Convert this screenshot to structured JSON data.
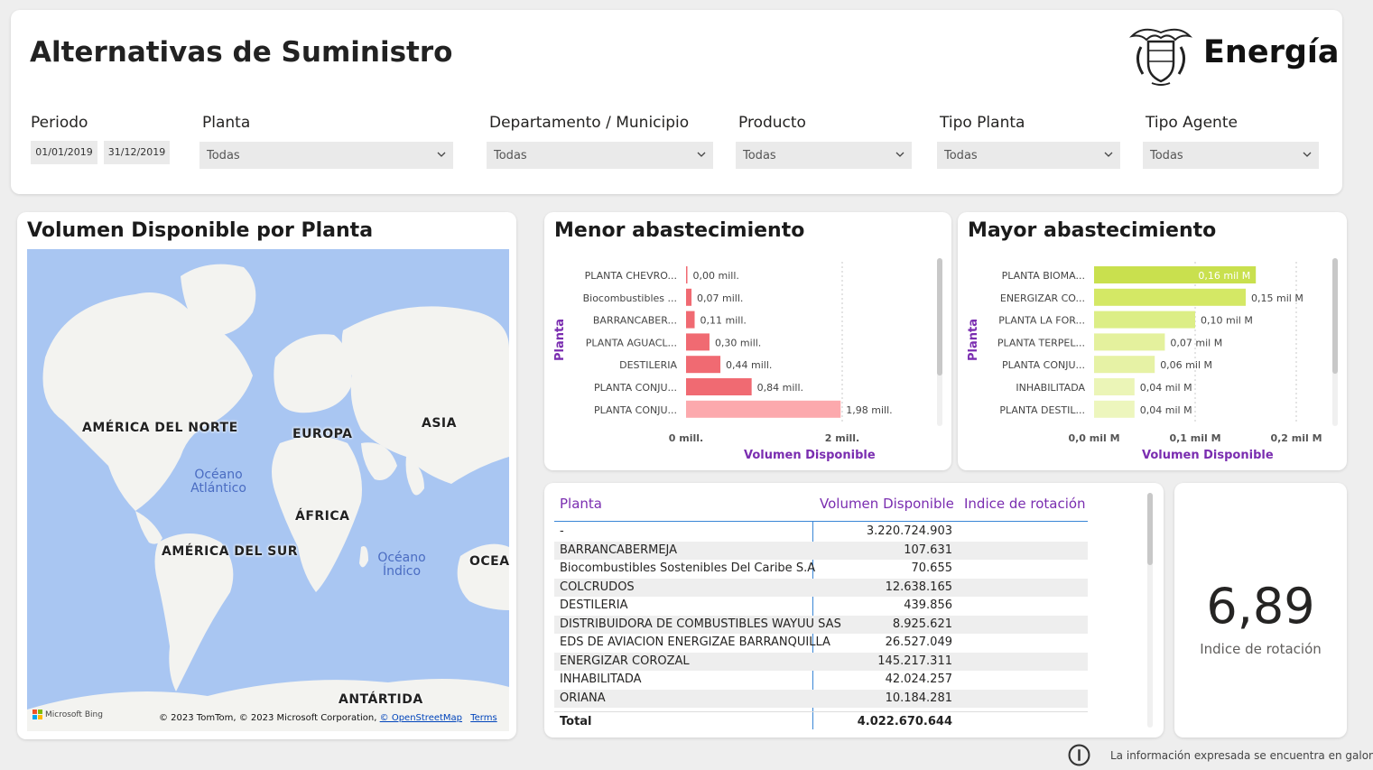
{
  "header": {
    "title": "Alternativas de Suministro",
    "logo_text": "Energía"
  },
  "filters": {
    "periodo": {
      "label": "Periodo",
      "from": "01/01/2019",
      "to": "31/12/2019"
    },
    "planta": {
      "label": "Planta",
      "value": "Todas"
    },
    "depto": {
      "label": "Departamento / Municipio",
      "value": "Todas"
    },
    "producto": {
      "label": "Producto",
      "value": "Todas"
    },
    "tipo_planta": {
      "label": "Tipo Planta",
      "value": "Todas"
    },
    "tipo_agente": {
      "label": "Tipo Agente",
      "value": "Todas"
    }
  },
  "map": {
    "title": "Volumen Disponible por Planta",
    "labels": {
      "na": "AMÉRICA DEL NORTE",
      "eu": "EUROPA",
      "as": "ASIA",
      "af": "ÁFRICA",
      "sa": "AMÉRICA DEL SUR",
      "oc": "OCEA",
      "an": "ANTÁRTIDA",
      "atl1": "Océano",
      "atl2": "Atlántico",
      "ind1": "Océano",
      "ind2": "Índico"
    },
    "attribution": "© 2023 TomTom, © 2023 Microsoft Corporation,",
    "osm_link": "© OpenStreetMap",
    "terms_link": "Terms",
    "bing": "Microsoft Bing"
  },
  "chart_data": [
    {
      "type": "bar",
      "orientation": "horizontal",
      "title": "Menor abastecimiento",
      "xlabel": "Volumen Disponible",
      "ylabel": "Planta",
      "categories": [
        "PLANTA CHEVRO...",
        "Biocombustibles ...",
        "BARRANCABER...",
        "PLANTA AGUACL...",
        "DESTILERIA",
        "PLANTA CONJU...",
        "PLANTA CONJU..."
      ],
      "values": [
        0.0,
        0.07,
        0.11,
        0.3,
        0.44,
        0.84,
        1.98
      ],
      "data_labels": [
        "0,00 mill.",
        "0,07 mill.",
        "0,11 mill.",
        "0,30 mill.",
        "0,44 mill.",
        "0,84 mill.",
        "1,98 mill."
      ],
      "ticks": [
        "0 mill.",
        "2 mill."
      ],
      "xlim": [
        0,
        2
      ],
      "colors": [
        "#f06a72",
        "#f06a72",
        "#f06a72",
        "#f06a72",
        "#f06a72",
        "#f06a72",
        "#fca9ad"
      ]
    },
    {
      "type": "bar",
      "orientation": "horizontal",
      "title": "Mayor abastecimiento",
      "xlabel": "Volumen Disponible",
      "ylabel": "Planta",
      "categories": [
        "PLANTA BIOMA...",
        "ENERGIZAR CO...",
        "PLANTA LA FOR...",
        "PLANTA TERPEL...",
        "PLANTA CONJU...",
        "INHABILITADA",
        "PLANTA DESTIL..."
      ],
      "values": [
        0.16,
        0.15,
        0.1,
        0.07,
        0.06,
        0.04,
        0.04
      ],
      "data_labels": [
        "0,16 mil M",
        "0,15 mil M",
        "0,10 mil M",
        "0,07 mil M",
        "0,06 mil M",
        "0,04 mil M",
        "0,04 mil M"
      ],
      "ticks": [
        "0,0 mil M",
        "0,1 mil M",
        "0,2 mil M"
      ],
      "xlim": [
        0,
        0.2
      ],
      "colors": [
        "#c9e04e",
        "#d4e865",
        "#dcee86",
        "#e4f19d",
        "#e6f2a5",
        "#ebf5b7",
        "#edf6bd"
      ]
    }
  ],
  "table": {
    "headers": [
      "Planta",
      "Volumen Disponible",
      "Indice de rotación"
    ],
    "rows": [
      [
        "-",
        "3.220.724.903"
      ],
      [
        "BARRANCABERMEJA",
        "107.631"
      ],
      [
        "Biocombustibles Sostenibles Del Caribe S.A",
        "70.655"
      ],
      [
        "COLCRUDOS",
        "12.638.165"
      ],
      [
        "DESTILERIA",
        "439.856"
      ],
      [
        "DISTRIBUIDORA DE COMBUSTIBLES WAYUU SAS",
        "8.925.621"
      ],
      [
        "EDS DE AVIACION ENERGIZAE BARRANQUILLA",
        "26.527.049"
      ],
      [
        "ENERGIZAR COROZAL",
        "145.217.311"
      ],
      [
        "INHABILITADA",
        "42.024.257"
      ],
      [
        "ORIANA",
        "10.184.281"
      ]
    ],
    "total_label": "Total",
    "total_value": "4.022.670.644"
  },
  "kpi": {
    "value": "6,89",
    "label": "Indice de rotación"
  },
  "footer": {
    "note": "La información expresada se encuentra en galones."
  }
}
